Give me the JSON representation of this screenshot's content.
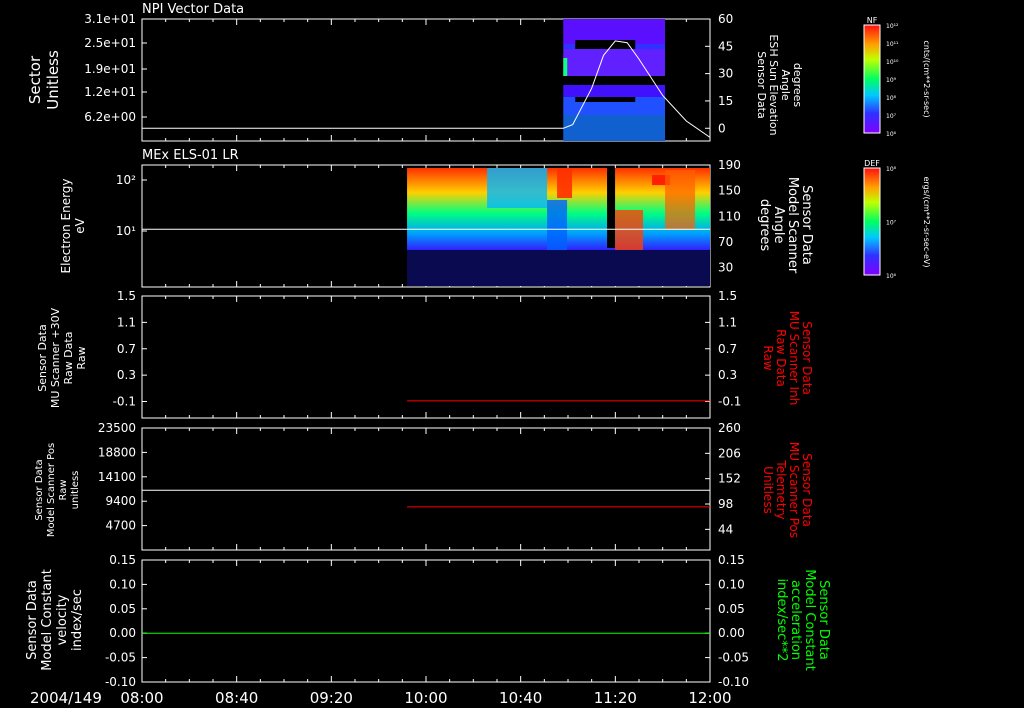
{
  "date_label": "2004/149",
  "x_ticks": [
    "08:00",
    "08:40",
    "09:20",
    "10:00",
    "10:40",
    "11:20",
    "12:00"
  ],
  "colors": {
    "background": "#000000",
    "foreground": "#ffffff",
    "red": "#ff0000",
    "green": "#00ff00"
  },
  "chart_data": [
    {
      "type": "heatmap",
      "title": "NPI Vector Data",
      "ylabel_left": [
        "Sector",
        "Unitless"
      ],
      "yticks_left": [
        "3.1e+01",
        "2.5e+01",
        "1.9e+01",
        "1.2e+01",
        "6.2e+00"
      ],
      "ylabel_right": [
        "Sensor Data",
        "ESH Sun Elevation",
        "Angle",
        "degrees"
      ],
      "yticks_right": [
        "60",
        "45",
        "30",
        "15",
        "0"
      ],
      "ylim_right": [
        -7,
        60
      ],
      "colorbar": {
        "label_top": "NF",
        "ticks": [
          "10¹²",
          "10¹¹",
          "10¹⁰",
          "10⁹",
          "10⁸",
          "10⁷",
          "10⁶"
        ],
        "unit": "cnts/(cm**2-sr-sec)"
      },
      "sun_elevation_line": {
        "x": [
          "08:00",
          "10:58",
          "11:02",
          "11:10",
          "11:15",
          "11:20",
          "11:25",
          "11:30",
          "11:40",
          "11:50",
          "12:00"
        ],
        "y": [
          0,
          0,
          2,
          22,
          40,
          48,
          47,
          38,
          18,
          4,
          -5
        ]
      },
      "data_coverage": [
        "10:58",
        "11:41"
      ]
    },
    {
      "type": "heatmap",
      "title": "MEx ELS-01 LR",
      "ylabel_left": [
        "Electron Energy",
        "eV"
      ],
      "yticks_left": [
        "10²",
        "10¹"
      ],
      "ylabel_right": [
        "Sensor Data",
        "Model Scanner",
        "Angle",
        "degrees"
      ],
      "yticks_right": [
        "190",
        "150",
        "110",
        "70",
        "30"
      ],
      "ylim_right": [
        0,
        190
      ],
      "colorbar": {
        "label_top": "DEF",
        "ticks": [
          "10⁸",
          "10⁷",
          "10⁶"
        ],
        "unit": "ergs/(cm**2-sr-sec-eV)"
      },
      "scanner_angle_line": {
        "x": [
          "08:00",
          "12:00"
        ],
        "y": [
          90,
          90
        ]
      },
      "data_coverage": [
        "09:52",
        "12:00"
      ]
    },
    {
      "type": "line",
      "ylabel_left": [
        "Sensor Data",
        "MU Scanner +30V",
        "Raw Data",
        "Raw"
      ],
      "yticks_left": [
        "1.5",
        "1.1",
        "0.7",
        "0.3",
        "-0.1"
      ],
      "ylabel_right": [
        "Sensor Data",
        "MU Scanner Inh",
        "Raw Data",
        "Raw"
      ],
      "yticks_right": [
        "1.5",
        "1.1",
        "0.7",
        "0.3",
        "-0.1"
      ],
      "ylim": [
        -0.35,
        1.5
      ],
      "series": [
        {
          "color": "#ff0000",
          "x": [
            "09:52",
            "12:00"
          ],
          "y": [
            0.0,
            0.0
          ]
        }
      ]
    },
    {
      "type": "line",
      "ylabel_left": [
        "Sensor Data",
        "Model Scanner Pos",
        "Raw",
        "unitless"
      ],
      "yticks_left": [
        "23500",
        "18800",
        "14100",
        "9400",
        "4700"
      ],
      "ylabel_right": [
        "Sensor Data",
        "MU Scanner Pos",
        "Telemetry",
        "Unitless"
      ],
      "yticks_right": [
        "260",
        "206",
        "152",
        "98",
        "44"
      ],
      "ylim_left": [
        0,
        23500
      ],
      "ylim_right": [
        0,
        260
      ],
      "series": [
        {
          "color": "#ffffff",
          "axis": "left",
          "x": [
            "08:00",
            "12:00"
          ],
          "y": [
            11500,
            11500
          ]
        },
        {
          "color": "#ff0000",
          "axis": "left",
          "x": [
            "09:52",
            "12:00"
          ],
          "y": [
            8300,
            8300
          ]
        }
      ]
    },
    {
      "type": "line",
      "ylabel_left": [
        "Sensor Data",
        "Model Constant",
        "velocity",
        "index/sec"
      ],
      "yticks_left": [
        "0.15",
        "0.10",
        "0.05",
        "0.00",
        "-0.05",
        "-0.10"
      ],
      "ylabel_right": [
        "Sensor Data",
        "Model Constant",
        "acceleration",
        "index/sec**2"
      ],
      "yticks_right": [
        "0.15",
        "0.10",
        "0.05",
        "0.00",
        "-0.05",
        "-0.10"
      ],
      "ylim": [
        -0.1,
        0.15
      ],
      "series": [
        {
          "color": "#00ff00",
          "x": [
            "08:00",
            "12:00"
          ],
          "y": [
            0.0,
            0.0
          ]
        }
      ]
    }
  ]
}
